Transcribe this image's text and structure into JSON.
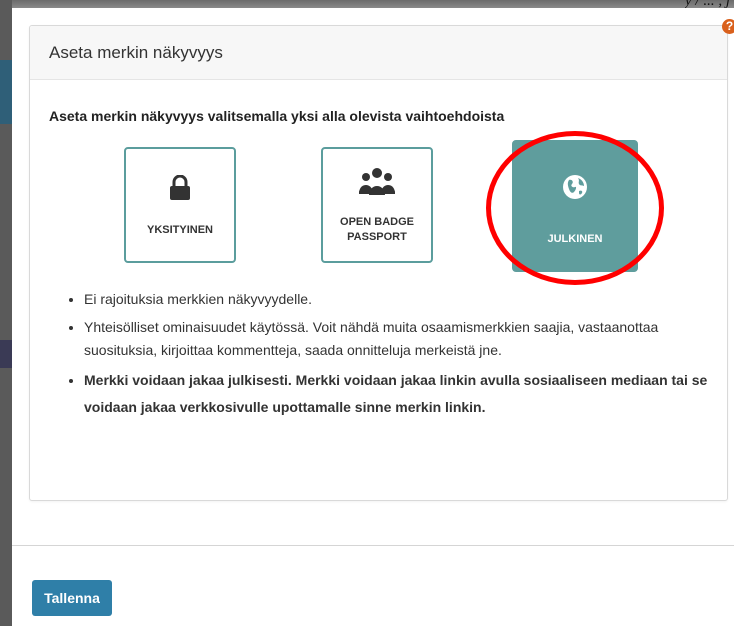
{
  "background": {
    "top_right_text": "y / ... , j"
  },
  "dialog": {
    "title": "Aseta merkin näkyvyys",
    "help_icon": "?",
    "prompt": "Aseta merkin näkyvyys valitsemalla yksi alla olevista vaihtoehdoista",
    "options": [
      {
        "label": "YKSITYINEN",
        "icon": "lock-icon",
        "selected": false
      },
      {
        "label": "OPEN BADGE PASSPORT",
        "icon": "users-icon",
        "selected": false
      },
      {
        "label": "JULKINEN",
        "icon": "globe-icon",
        "selected": true
      }
    ],
    "bullets": [
      "Ei rajoituksia merkkien näkyvyydelle.",
      "Yhteisölliset ominaisuudet käytössä. Voit nähdä muita osaamismerkkien saajia, vastaanottaa suosituksia, kirjoittaa kommentteja, saada onnitteluja merkeistä jne.",
      "Merkki voidaan jakaa julkisesti. Merkki voidaan jakaa linkin avulla sosiaaliseen mediaan tai se voidaan jakaa verkkosivulle upottamalle sinne merkin linkin."
    ],
    "save_label": "Tallenna"
  },
  "colors": {
    "option_border": "#5b9d9d",
    "selected_bg": "#5f9d9d",
    "save_button": "#2f7fa8",
    "annotation": "#ff0000",
    "help_icon": "#d9601c"
  }
}
